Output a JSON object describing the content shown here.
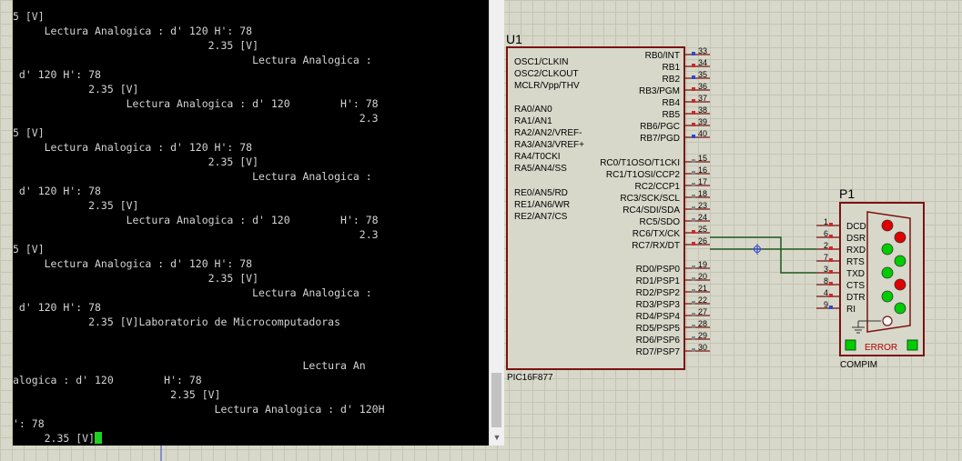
{
  "terminal": {
    "lines": [
      "5 [V]",
      "     Lectura Analogica : d' 120 H': 78",
      "                               2.35 [V]",
      "                                      Lectura Analogica :",
      " d' 120 H': 78",
      "            2.35 [V]",
      "                  Lectura Analogica : d' 120        H': 78",
      "                                                       2.3",
      "5 [V]",
      "     Lectura Analogica : d' 120 H': 78",
      "                               2.35 [V]",
      "                                      Lectura Analogica :",
      " d' 120 H': 78",
      "            2.35 [V]",
      "                  Lectura Analogica : d' 120        H': 78",
      "                                                       2.3",
      "5 [V]",
      "     Lectura Analogica : d' 120 H': 78",
      "                               2.35 [V]",
      "                                      Lectura Analogica :",
      " d' 120 H': 78",
      "            2.35 [V]Laboratorio de Microcomputadoras",
      "",
      "",
      "                                              Lectura An",
      "alogica : d' 120        H': 78",
      "                         2.35 [V]",
      "                                Lectura Analogica : d' 120H",
      "': 78",
      "     2.35 [V]"
    ]
  },
  "schematic": {
    "u1": {
      "ref": "U1",
      "part": "PIC16F877",
      "left_pins": [
        "OSC1/CLKIN",
        "OSC2/CLKOUT",
        "MCLR/Vpp/THV",
        "RA0/AN0",
        "RA1/AN1",
        "RA2/AN2/VREF-",
        "RA3/AN3/VREF+",
        "RA4/T0CKI",
        "RA5/AN4/SS",
        "RE0/AN5/RD",
        "RE1/AN6/WR",
        "RE2/AN7/CS"
      ],
      "right_pins": [
        {
          "label": "RB0/INT",
          "num": "33"
        },
        {
          "label": "RB1",
          "num": "34"
        },
        {
          "label": "RB2",
          "num": "35"
        },
        {
          "label": "RB3/PGM",
          "num": "36"
        },
        {
          "label": "RB4",
          "num": "37"
        },
        {
          "label": "RB5",
          "num": "38"
        },
        {
          "label": "RB6/PGC",
          "num": "39"
        },
        {
          "label": "RB7/PGD",
          "num": "40"
        },
        {
          "label": "RC0/T1OSO/T1CKI",
          "num": "15"
        },
        {
          "label": "RC1/T1OSI/CCP2",
          "num": "16"
        },
        {
          "label": "RC2/CCP1",
          "num": "17"
        },
        {
          "label": "RC3/SCK/SCL",
          "num": "18"
        },
        {
          "label": "RC4/SDI/SDA",
          "num": "23"
        },
        {
          "label": "RC5/SDO",
          "num": "24"
        },
        {
          "label": "RC6/TX/CK",
          "num": "25"
        },
        {
          "label": "RC7/RX/DT",
          "num": "26"
        },
        {
          "label": "RD0/PSP0",
          "num": "19"
        },
        {
          "label": "RD1/PSP1",
          "num": "20"
        },
        {
          "label": "RD2/PSP2",
          "num": "21"
        },
        {
          "label": "RD3/PSP3",
          "num": "22"
        },
        {
          "label": "RD4/PSP4",
          "num": "27"
        },
        {
          "label": "RD5/PSP5",
          "num": "28"
        },
        {
          "label": "RD6/PSP6",
          "num": "29"
        },
        {
          "label": "RD7/PSP7",
          "num": "30"
        }
      ]
    },
    "p1": {
      "ref": "P1",
      "part": "COMPIM",
      "status": "ERROR",
      "pins": [
        {
          "label": "DCD",
          "num": "1"
        },
        {
          "label": "DSR",
          "num": "6"
        },
        {
          "label": "RXD",
          "num": "2"
        },
        {
          "label": "RTS",
          "num": "7"
        },
        {
          "label": "TXD",
          "num": "3"
        },
        {
          "label": "CTS",
          "num": "8"
        },
        {
          "label": "DTR",
          "num": "4"
        },
        {
          "label": "RI",
          "num": "9"
        }
      ]
    }
  },
  "colors": {
    "wire": "#1f5a1f",
    "component_outline": "#7a1212",
    "pin_red": "#cc2a2a",
    "pin_blue": "#2a4ad0",
    "led_red": "#e00000",
    "led_green": "#00cc00"
  }
}
